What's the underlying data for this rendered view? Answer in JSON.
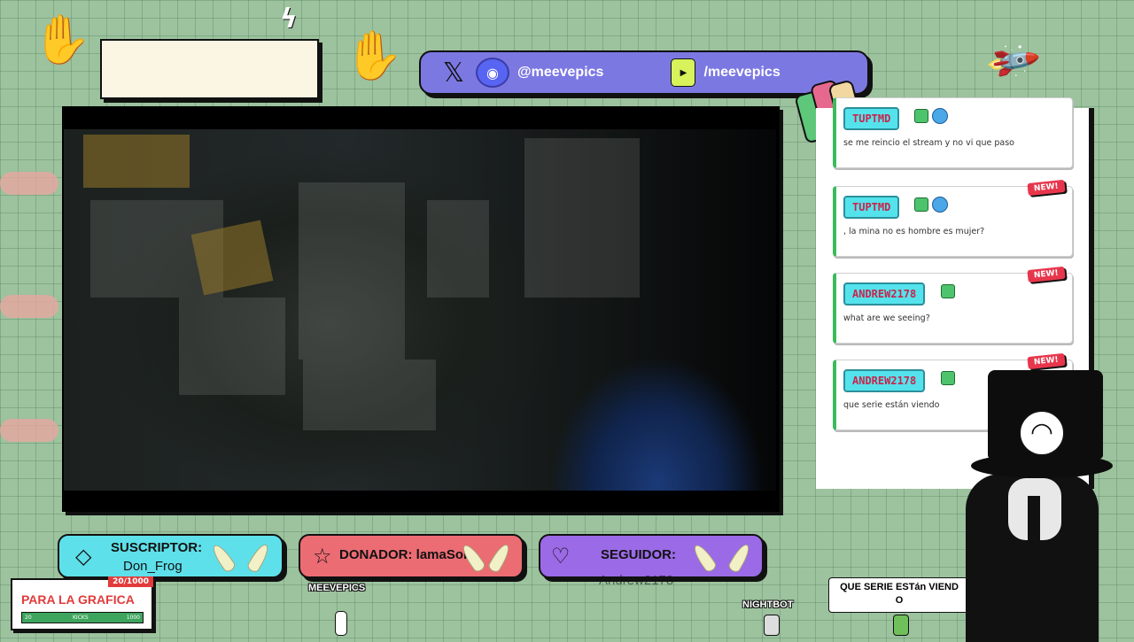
{
  "social": {
    "x_icon": "𝕏",
    "discord_icon": "◉",
    "handle_left": "@meevepics",
    "youtube_icon": "▶",
    "handle_right": "/meevepics"
  },
  "chat": {
    "messages": [
      {
        "user": "TUPTMD",
        "text": "se me reincio el stream y no vi que paso",
        "new": false
      },
      {
        "user": "TUPTMD",
        "text": ", la mina no es hombre es mujer?",
        "new": "NEW!"
      },
      {
        "user": "ANDREW2178",
        "text": "what are we seeing?",
        "new": "NEW!"
      },
      {
        "user": "ANDREW2178",
        "text": "que serie están viendo",
        "new": "NEW!"
      }
    ]
  },
  "labels": {
    "subscriber": {
      "title": "SUSCRIPTOR:",
      "value": "Don_Frog",
      "icon": "◇"
    },
    "donor": {
      "title": "DONADOR: lamaSor",
      "icon": "☆"
    },
    "follower": {
      "title": "SEGUIDOR:",
      "value": "Andrew2178",
      "icon": "♡"
    }
  },
  "goal": {
    "title": "PARA LA GRAFICA",
    "count": "20/1000",
    "min": "20",
    "label": "KICKS",
    "max": "1000",
    "progress": 0.02
  },
  "names": {
    "streamer": "MEEVEPICS",
    "bot": "NIGHTBOT"
  },
  "bubble": {
    "line1": "QUE SERIE ESTán VIEND",
    "line2": "O"
  },
  "mascot": {
    "eye_glyph": "◠"
  },
  "colors": {
    "subscriber_bg": "#5ee0ea",
    "donor_bg": "#ec6c74",
    "follower_bg": "#9b6ae6",
    "social_bg": "#7c78e2"
  }
}
